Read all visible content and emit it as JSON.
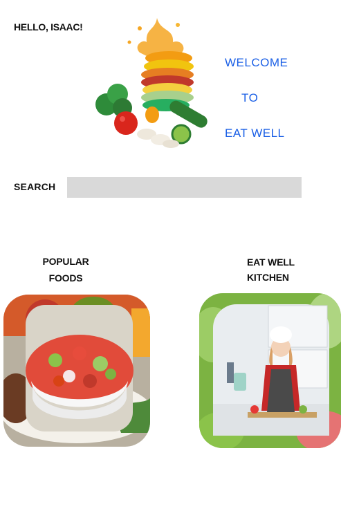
{
  "header": {
    "greeting": "HELLO, ISAAC!",
    "welcome_line1": "WELCOME",
    "welcome_line2": "TO",
    "welcome_line3": "EAT WELL"
  },
  "search": {
    "label": "SEARCH",
    "value": "",
    "placeholder": ""
  },
  "sections": {
    "popular": {
      "line1": "POPULAR",
      "line2": "FOODS"
    },
    "kitchen": {
      "line1": "EAT WELL",
      "line2": "KITCHEN"
    }
  },
  "colors": {
    "accent": "#1a5fe6",
    "search_bg": "#d9d9d9",
    "text": "#111111"
  }
}
